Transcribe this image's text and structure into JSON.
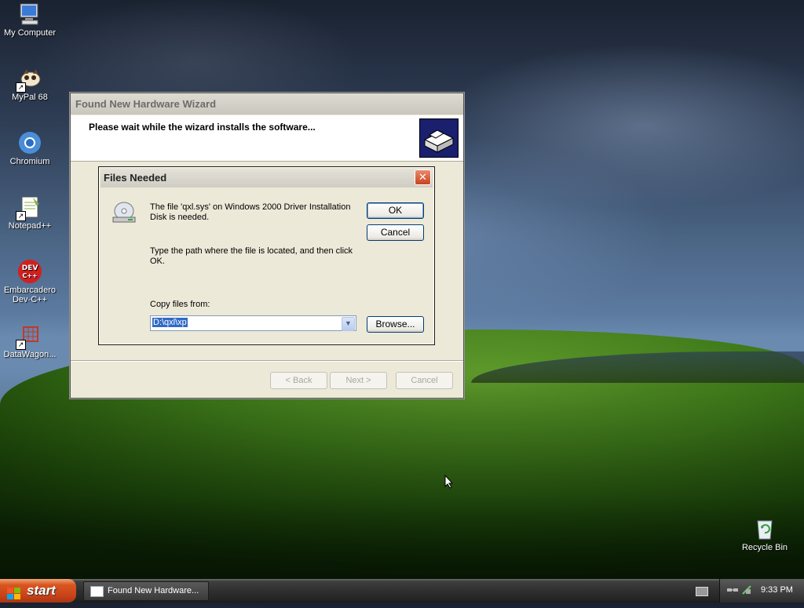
{
  "desktop": {
    "icons": [
      {
        "label": "My Computer"
      },
      {
        "label": "MyPal 68"
      },
      {
        "label": "Chromium"
      },
      {
        "label": "Notepad++"
      },
      {
        "label": "Embarcadero Dev-C++"
      },
      {
        "label": "DataWagon..."
      },
      {
        "label": "Recycle Bin"
      }
    ]
  },
  "wizard": {
    "title": "Found New Hardware Wizard",
    "header_text": "Please wait while the wizard installs the software...",
    "back_label": "< Back",
    "next_label": "Next >",
    "cancel_label": "Cancel"
  },
  "files_needed": {
    "title": "Files Needed",
    "close_glyph": "✕",
    "message1_line1": "The file 'qxl.sys' on Windows 2000 Driver Installation",
    "message1_line2": "Disk is needed.",
    "message2_line1": "Type the path where the file is located, and then click",
    "message2_line2": "OK.",
    "copy_from_label": "Copy files from:",
    "copy_from_value": "D:\\qxl\\xp",
    "ok_label": "OK",
    "cancel_label": "Cancel",
    "browse_label": "Browse..."
  },
  "taskbar": {
    "start_label": "start",
    "task_item_label": "Found New Hardware...",
    "clock": "9:33 PM"
  },
  "colors": {
    "start_button": "#d9561f",
    "close_button": "#c9431f",
    "selection": "#316ac5"
  }
}
